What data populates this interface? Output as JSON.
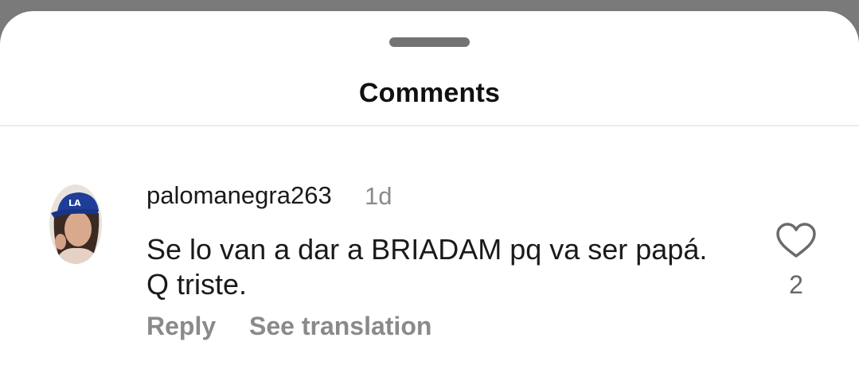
{
  "sheet": {
    "title": "Comments"
  },
  "comments": [
    {
      "username": "palomanegra263",
      "time": "1d",
      "text_lines": [
        "Se lo van a dar a BRIADAM pq va ser papá.",
        "Q triste."
      ],
      "reply_label": "Reply",
      "translate_label": "See translation",
      "like_count": "2",
      "avatar_cap_text": "LA"
    }
  ],
  "icons": {
    "like": "heart-outline-icon",
    "handle": "drag-handle"
  },
  "colors": {
    "overlay": "#7a7a7a",
    "sheet_bg": "#ffffff",
    "primary_text": "#1a1a1a",
    "secondary_text": "#8a8a8a"
  }
}
